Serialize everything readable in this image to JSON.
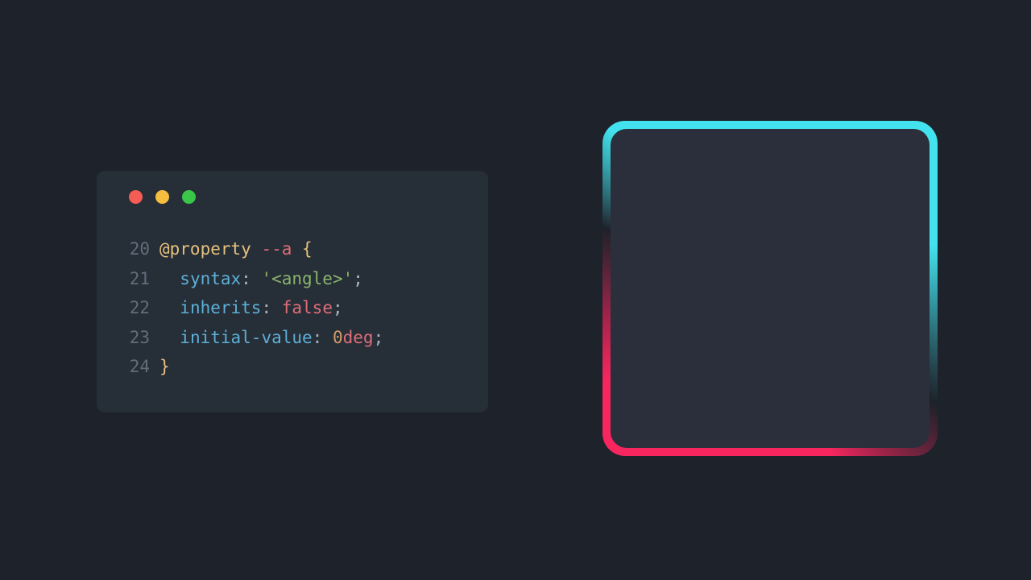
{
  "code": {
    "lines": [
      {
        "num": "20",
        "tokens": [
          {
            "cls": "tok-atrule",
            "text": "@property"
          },
          {
            "cls": "",
            "text": " "
          },
          {
            "cls": "tok-varname",
            "text": "--a"
          },
          {
            "cls": "",
            "text": " "
          },
          {
            "cls": "tok-brace",
            "text": "{"
          }
        ]
      },
      {
        "num": "21",
        "tokens": [
          {
            "cls": "",
            "text": "  "
          },
          {
            "cls": "tok-prop",
            "text": "syntax"
          },
          {
            "cls": "tok-colon",
            "text": ": "
          },
          {
            "cls": "tok-string",
            "text": "'<angle>'"
          },
          {
            "cls": "tok-semi",
            "text": ";"
          }
        ]
      },
      {
        "num": "22",
        "tokens": [
          {
            "cls": "",
            "text": "  "
          },
          {
            "cls": "tok-prop",
            "text": "inherits"
          },
          {
            "cls": "tok-colon",
            "text": ": "
          },
          {
            "cls": "tok-false",
            "text": "false"
          },
          {
            "cls": "tok-semi",
            "text": ";"
          }
        ]
      },
      {
        "num": "23",
        "tokens": [
          {
            "cls": "",
            "text": "  "
          },
          {
            "cls": "tok-prop",
            "text": "initial-value"
          },
          {
            "cls": "tok-colon",
            "text": ": "
          },
          {
            "cls": "tok-num",
            "text": "0"
          },
          {
            "cls": "tok-unit",
            "text": "deg"
          },
          {
            "cls": "tok-semi",
            "text": ";"
          }
        ]
      },
      {
        "num": "24",
        "tokens": [
          {
            "cls": "tok-brace",
            "text": "}"
          }
        ]
      }
    ]
  },
  "colors": {
    "bg": "#1e222a",
    "window": "#262e38",
    "traffic_red": "#f55c54",
    "traffic_yellow": "#f5be3f",
    "traffic_green": "#3ac749",
    "border_cyan": "#42e3ee",
    "border_pink": "#f8265f",
    "demo_inner": "#2a2f3b"
  }
}
